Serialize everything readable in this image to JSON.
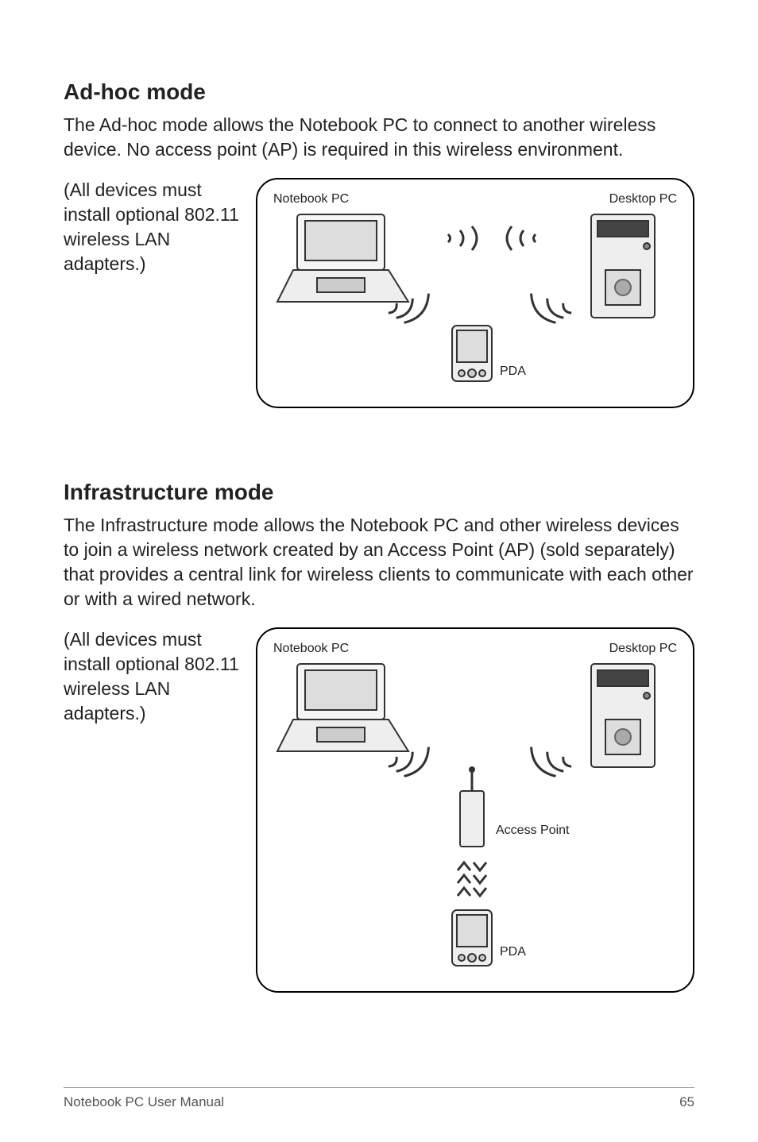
{
  "section1": {
    "title": "Ad-hoc mode",
    "para1": "The Ad-hoc mode allows the Notebook PC to connect to another wireless device. No access point (AP) is required in this wireless environment.",
    "para2": "(All devices must install optional 802.11 wireless LAN adapters.)",
    "labels": {
      "notebook": "Notebook PC",
      "desktop": "Desktop PC",
      "pda": "PDA"
    }
  },
  "section2": {
    "title": "Infrastructure mode",
    "para1": "The Infrastructure mode allows the Notebook PC and other wireless devices to join a wireless network created by an Access Point (AP) (sold separately) that provides a central link for wireless clients to communicate with each other or with a wired network.",
    "para2": "(All devices must install optional 802.11 wireless LAN adapters.)",
    "labels": {
      "notebook": "Notebook PC",
      "desktop": "Desktop PC",
      "pda": "PDA",
      "accesspoint": "Access Point"
    }
  },
  "footer": {
    "left": "Notebook PC User Manual",
    "page": "65"
  }
}
